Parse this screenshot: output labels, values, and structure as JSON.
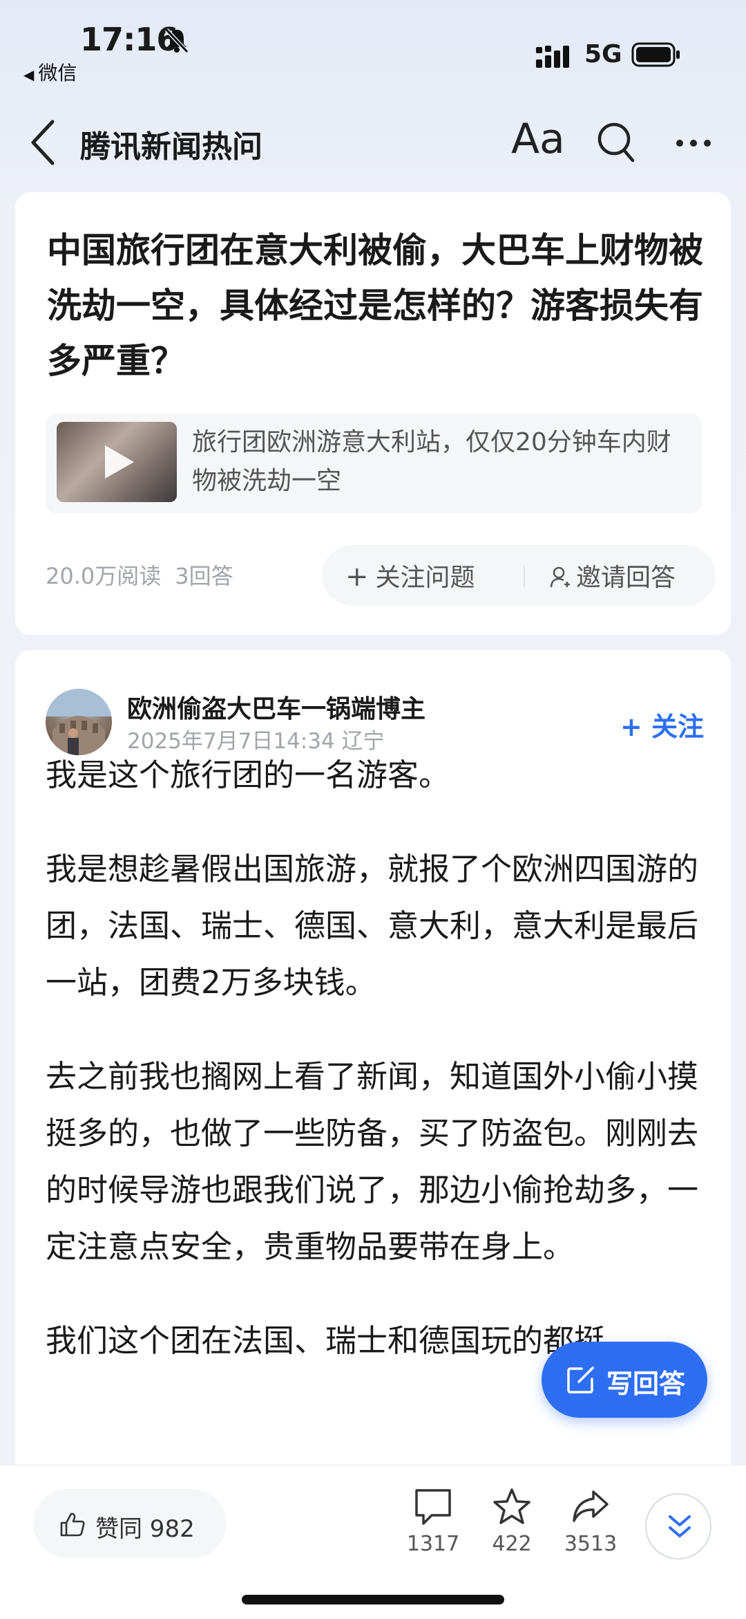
{
  "status_bar": {
    "time": "17:16",
    "back_app": "微信",
    "network": "5G",
    "icons": [
      "bell-off-icon",
      "signal-icon",
      "battery-icon"
    ]
  },
  "nav": {
    "title": "腾讯新闻热问",
    "font_button": "Aa",
    "icons": [
      "back-icon",
      "search-icon",
      "more-icon"
    ]
  },
  "question": {
    "title": "中国旅行团在意大利被偷，大巴车上财物被洗劫一空，具体经过是怎样的？游客损失有多严重？",
    "video_text": "旅行团欧洲游意大利站，仅仅20分钟车内财物被洗劫一空",
    "reads": "20.0万阅读",
    "answers": "3回答",
    "follow_label": "关注问题",
    "invite_label": "邀请回答"
  },
  "answer": {
    "author": "欧洲偷盗大巴车一锅端博主",
    "meta": "2025年7月7日14:34 辽宁",
    "follow_label": "+ 关注",
    "paragraphs": [
      "我是这个旅行团的一名游客。",
      "我是想趁暑假出国旅游，就报了个欧洲四国游的团，法国、瑞士、德国、意大利，意大利是最后一站，团费2万多块钱。",
      "去之前我也搁网上看了新闻，知道国外小偷小摸挺多的，也做了一些防备，买了防盗包。刚刚去的时候导游也跟我们说了，那边小偷抢劫多，一定注意点安全，贵重物品要带在身上。",
      "我们这个团在法国、瑞士和德国玩的都挺"
    ]
  },
  "write_answer": {
    "label": "写回答"
  },
  "bottom_bar": {
    "like_label": "赞同 982",
    "comments": "1317",
    "favorites": "422",
    "shares": "3513"
  },
  "colors": {
    "accent": "#2e6ef2",
    "muted": "#a0a4ab"
  }
}
